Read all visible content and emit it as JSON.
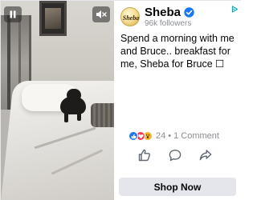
{
  "advertiser": {
    "name": "Sheba",
    "followers": "96k followers",
    "logo_text": "Sheba"
  },
  "post": {
    "message": "Spend a morning with me and Bruce.. breakfast for me, Sheba for Bruce ☐"
  },
  "engagement": {
    "reaction_types": [
      "like",
      "love",
      "wow"
    ],
    "reaction_count": "24",
    "separator": "•",
    "comments": "1 Comment"
  },
  "actions": {
    "like_icon": "thumbs-up-icon",
    "comment_icon": "comment-icon",
    "share_icon": "share-icon"
  },
  "cta": {
    "label": "Shop Now"
  },
  "video": {
    "pause_icon": "pause-icon",
    "mute_icon": "volume-muted-icon"
  },
  "colors": {
    "accent": "#1877f2",
    "love": "#f33e58",
    "wow": "#f7b125",
    "adchoices": "#00aecd"
  }
}
